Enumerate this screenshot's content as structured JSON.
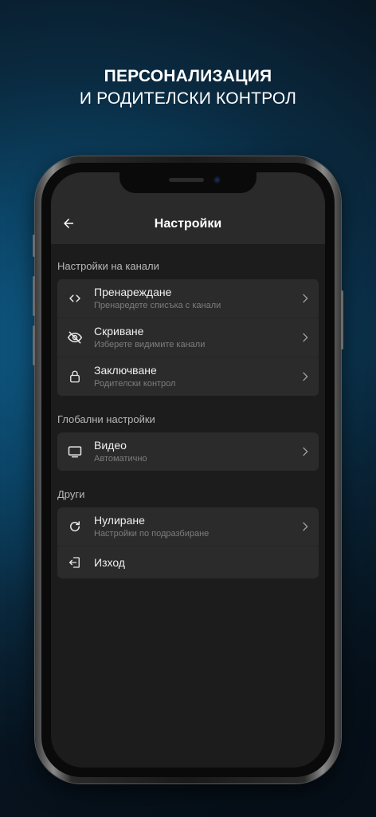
{
  "headline": {
    "line1": "ПЕРСОНАЛИЗАЦИЯ",
    "line2": "И РОДИТЕЛСКИ КОНТРОЛ"
  },
  "appbar": {
    "title": "Настройки",
    "back_icon": "arrow-back-icon"
  },
  "sections": [
    {
      "label": "Настройки на канали",
      "items": [
        {
          "icon": "code-brackets-icon",
          "title": "Пренареждане",
          "subtitle": "Пренаредете списъка с канали"
        },
        {
          "icon": "eye-off-icon",
          "title": "Скриване",
          "subtitle": "Изберете видимите канали"
        },
        {
          "icon": "lock-icon",
          "title": "Заключване",
          "subtitle": "Родителски контрол"
        }
      ]
    },
    {
      "label": "Глобални настройки",
      "items": [
        {
          "icon": "monitor-icon",
          "title": "Видео",
          "subtitle": "Автоматично"
        }
      ]
    },
    {
      "label": "Други",
      "items": [
        {
          "icon": "refresh-icon",
          "title": "Нулиране",
          "subtitle": "Настройки по подразбиране"
        },
        {
          "icon": "logout-icon",
          "title": "Изход"
        }
      ]
    }
  ],
  "colors": {
    "screen_bg": "#1c1c1c",
    "appbar_bg": "#2a2a2a",
    "card_bg": "#2b2b2b",
    "text_primary": "#f0f0f0",
    "text_secondary": "#7d7d7d"
  }
}
